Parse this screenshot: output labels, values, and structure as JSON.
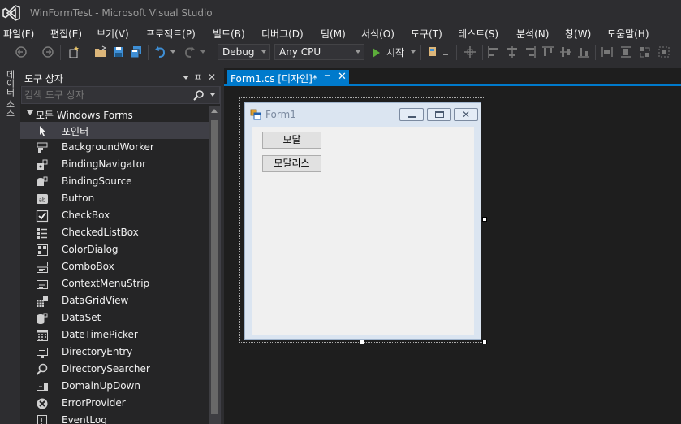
{
  "window": {
    "title": "WinFormTest - Microsoft Visual Studio"
  },
  "menu": [
    "파일(F)",
    "편집(E)",
    "보기(V)",
    "프로젝트(P)",
    "빌드(B)",
    "디버그(D)",
    "팀(M)",
    "서식(O)",
    "도구(T)",
    "테스트(S)",
    "분석(N)",
    "창(W)",
    "도움말(H)"
  ],
  "toolbar": {
    "config": "Debug",
    "platform": "Any CPU",
    "start_label": "시작"
  },
  "side_tab": "데이터 소스",
  "toolbox": {
    "title": "도구 상자",
    "search_placeholder": "검색 도구 상자",
    "group": "모든 Windows Forms",
    "items": [
      {
        "label": "포인터",
        "icon": "pointer-icon"
      },
      {
        "label": "BackgroundWorker",
        "icon": "background-worker-icon"
      },
      {
        "label": "BindingNavigator",
        "icon": "binding-navigator-icon"
      },
      {
        "label": "BindingSource",
        "icon": "binding-source-icon"
      },
      {
        "label": "Button",
        "icon": "button-icon"
      },
      {
        "label": "CheckBox",
        "icon": "checkbox-icon"
      },
      {
        "label": "CheckedListBox",
        "icon": "checked-list-box-icon"
      },
      {
        "label": "ColorDialog",
        "icon": "color-dialog-icon"
      },
      {
        "label": "ComboBox",
        "icon": "combobox-icon"
      },
      {
        "label": "ContextMenuStrip",
        "icon": "context-menu-strip-icon"
      },
      {
        "label": "DataGridView",
        "icon": "data-grid-view-icon"
      },
      {
        "label": "DataSet",
        "icon": "dataset-icon"
      },
      {
        "label": "DateTimePicker",
        "icon": "date-time-picker-icon"
      },
      {
        "label": "DirectoryEntry",
        "icon": "directory-entry-icon"
      },
      {
        "label": "DirectorySearcher",
        "icon": "directory-searcher-icon"
      },
      {
        "label": "DomainUpDown",
        "icon": "domain-up-down-icon"
      },
      {
        "label": "ErrorProvider",
        "icon": "error-provider-icon"
      },
      {
        "label": "EventLog",
        "icon": "event-log-icon"
      }
    ]
  },
  "document": {
    "tab_label": "Form1.cs [디자인]*"
  },
  "form": {
    "title": "Form1",
    "buttons": [
      "모달",
      "모달리스"
    ]
  },
  "colors": {
    "accent": "#007acc",
    "background": "#2d2d30",
    "panel": "#252526",
    "designer": "#1e1e1e"
  }
}
